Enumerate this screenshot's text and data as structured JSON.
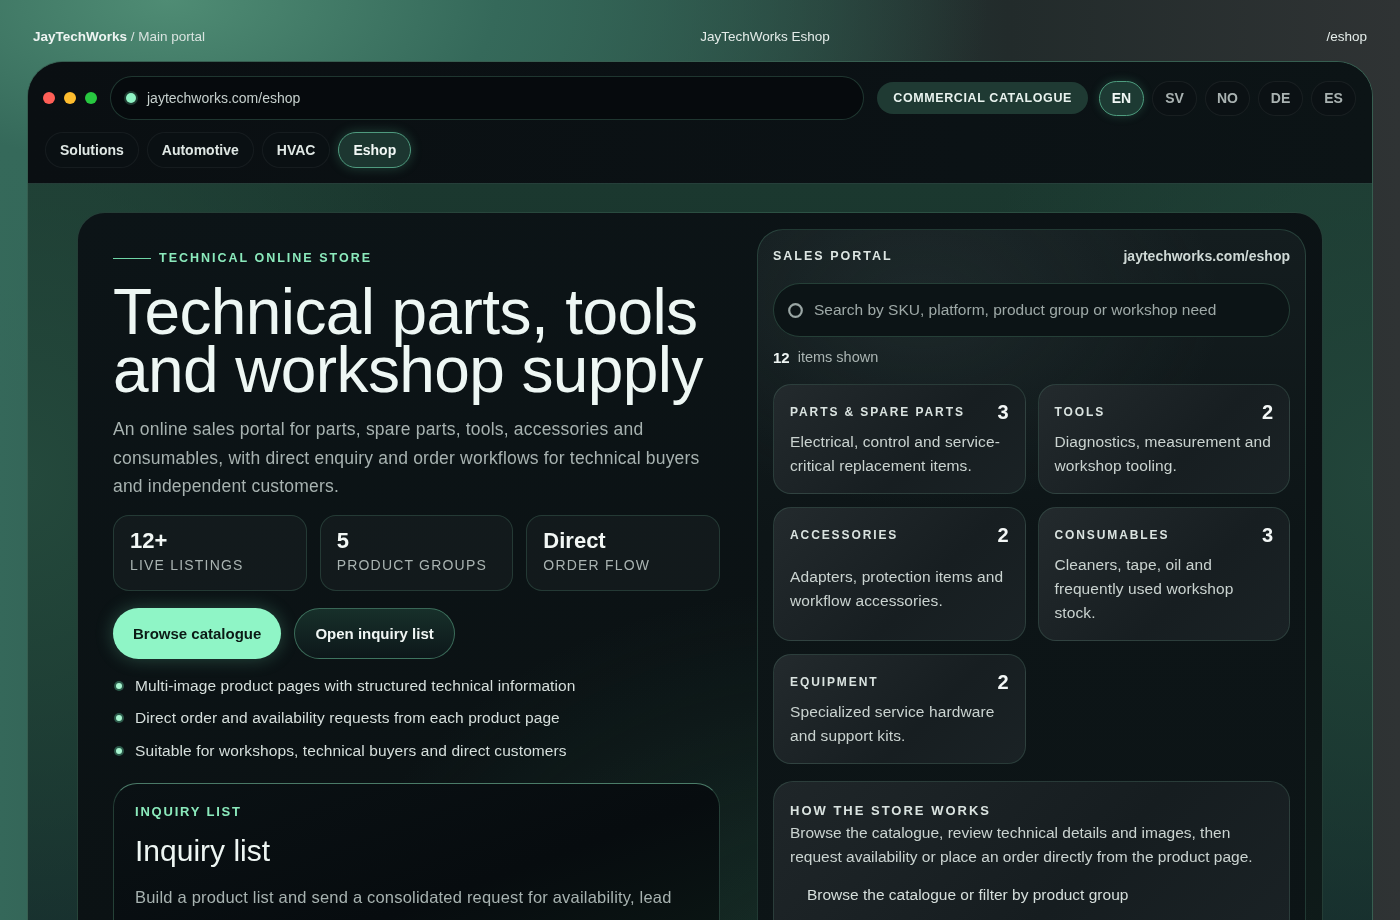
{
  "topbar": {
    "breadcrumb": "**JayTechWorks** / Main portal",
    "title": "JayTechWorks Eshop",
    "path": "/eshop"
  },
  "browser": {
    "url": "jaytechworks.com/eshop",
    "badge": "COMMERCIAL CATALOGUE",
    "languages": [
      {
        "label": "EN",
        "selected": true
      },
      {
        "label": "SV",
        "selected": false
      },
      {
        "label": "NO",
        "selected": false
      },
      {
        "label": "DE",
        "selected": false
      },
      {
        "label": "ES",
        "selected": false
      }
    ],
    "nav_tabs": [
      {
        "label": "Solutions",
        "selected": false
      },
      {
        "label": "Automotive",
        "selected": false
      },
      {
        "label": "HVAC",
        "selected": false
      },
      {
        "label": "Eshop",
        "selected": true
      }
    ]
  },
  "hero": {
    "eyebrow": "TECHNICAL ONLINE STORE",
    "title": "Technical parts, tools and workshop supply",
    "description": "An online sales portal for parts, spare parts, tools, accessories and consumables, with direct enquiry and order workflows for technical buyers and independent customers.",
    "stats": [
      {
        "value": "12+",
        "label": "LIVE LISTINGS"
      },
      {
        "value": "5",
        "label": "PRODUCT GROUPS"
      },
      {
        "value": "Direct",
        "label": "ORDER FLOW"
      }
    ],
    "buttons": [
      {
        "label": "Browse catalogue",
        "kind": "primary"
      },
      {
        "label": "Open inquiry list",
        "kind": "secondary"
      }
    ],
    "features": [
      "Multi-image product pages with structured technical information",
      "Direct order and availability requests from each product page",
      "Suitable for workshops, technical buyers and direct customers"
    ]
  },
  "inquiry": {
    "eyebrow": "INQUIRY LIST",
    "title": "Inquiry list",
    "description": "Build a product list and send a consolidated request for availability, lead"
  },
  "sales_portal": {
    "label": "SALES PORTAL",
    "url": "jaytechworks.com/eshop",
    "search": {
      "placeholder": "Search by SKU, platform, product group or workshop need"
    },
    "count": "12",
    "count_label": "items shown",
    "categories": [
      {
        "name": "PARTS & SPARE PARTS",
        "count": "3",
        "description": "Electrical, control and service-critical replacement items."
      },
      {
        "name": "TOOLS",
        "count": "2",
        "description": "Diagnostics, measurement and workshop tooling."
      },
      {
        "name": "ACCESSORIES",
        "count": "2",
        "description": "Adapters, protection items and workflow accessories."
      },
      {
        "name": "CONSUMABLES",
        "count": "3",
        "description": "Cleaners, tape, oil and frequently used workshop stock."
      },
      {
        "name": "EQUIPMENT",
        "count": "2",
        "description": "Specialized service hardware and support kits."
      }
    ],
    "how_it_works": {
      "title": "HOW THE STORE WORKS",
      "description": "Browse the catalogue, review technical details and images, then request availability or place an order directly from the product page.",
      "steps": [
        "Browse the catalogue or filter by product group"
      ]
    }
  }
}
